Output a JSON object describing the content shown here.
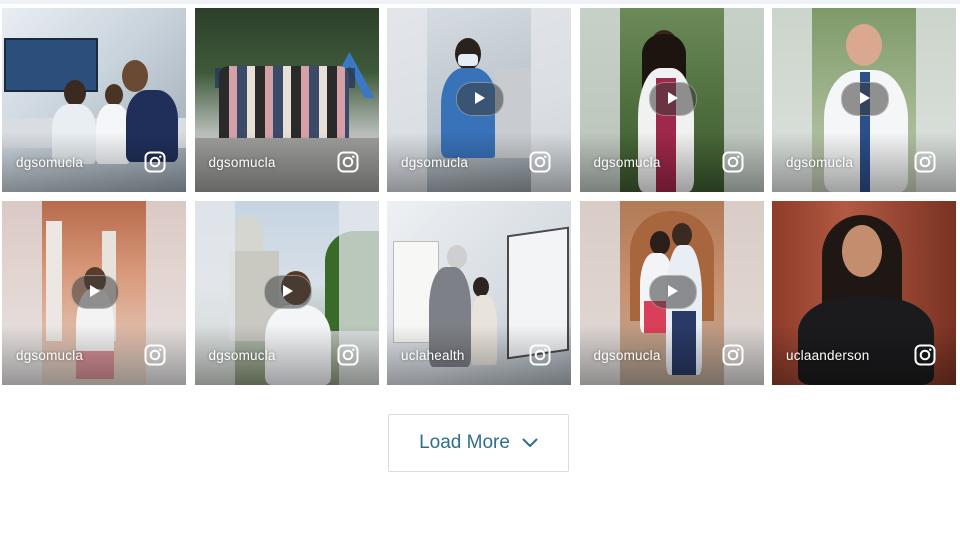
{
  "feed": {
    "posts": [
      {
        "username": "dgsomucla",
        "is_video": false,
        "platform_icon": "instagram-icon"
      },
      {
        "username": "dgsomucla",
        "is_video": false,
        "platform_icon": "instagram-icon"
      },
      {
        "username": "dgsomucla",
        "is_video": true,
        "platform_icon": "instagram-icon"
      },
      {
        "username": "dgsomucla",
        "is_video": true,
        "platform_icon": "instagram-icon"
      },
      {
        "username": "dgsomucla",
        "is_video": true,
        "platform_icon": "instagram-icon"
      },
      {
        "username": "dgsomucla",
        "is_video": true,
        "platform_icon": "instagram-icon"
      },
      {
        "username": "dgsomucla",
        "is_video": true,
        "platform_icon": "instagram-icon"
      },
      {
        "username": "uclahealth",
        "is_video": false,
        "platform_icon": "instagram-icon"
      },
      {
        "username": "dgsomucla",
        "is_video": true,
        "platform_icon": "instagram-icon"
      },
      {
        "username": "uclaanderson",
        "is_video": false,
        "platform_icon": "instagram-icon"
      }
    ]
  },
  "load_more": {
    "label": "Load More",
    "icon": "chevron-down-icon"
  },
  "colors": {
    "accent_text": "#2f6f88",
    "button_border": "#d9dde2"
  }
}
